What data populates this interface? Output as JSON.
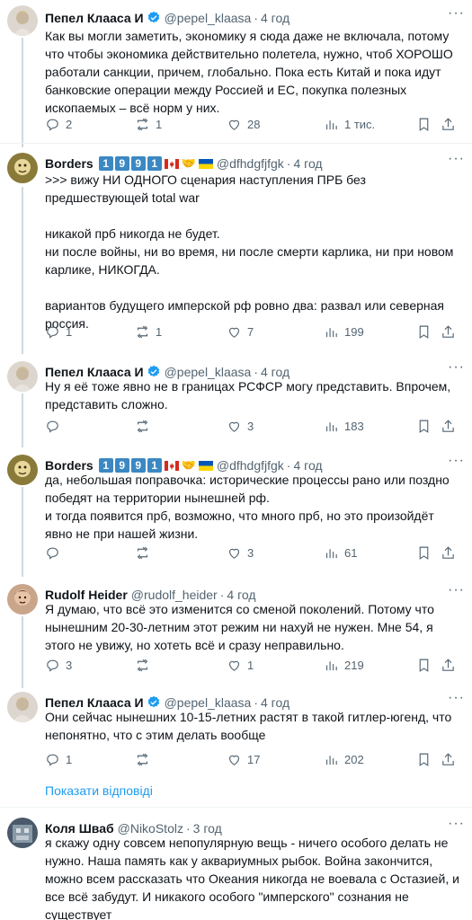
{
  "tweets": [
    {
      "name": "Пепел Клааса И",
      "handle": "@pepel_klaasa",
      "time": "4 год",
      "verified": true,
      "text": "Как вы могли заметить, экономику я сюда даже не включала, потому\nчто чтобы экономика действительно полетела, нужно, чтоб ХОРОШО\nработали санкции, причем, глобально. Пока есть Китай и пока идут\nбанковские операции между Россией и ЕС, покупка полезных\nископаемых – всё норм у них.",
      "replies": "2",
      "retweets": "1",
      "likes": "28",
      "views": "1 тис."
    },
    {
      "name": "Borders",
      "badge_digits": [
        "1",
        "9",
        "9",
        "1"
      ],
      "handle": "@dfhdgfjfgk",
      "time": "4 год",
      "text": ">>>  вижу НИ ОДНОГО сценария наступления ПРБ без\nпредшествующей total war\n\nникакой прб никогда не будет.\nни после войны, ни во время, ни после смерти карлика,  ни при новом\nкарлике, НИКОГДА.\n\nвариантов будущего имперской рф ровно два: развал или северная\nроссия.",
      "replies": "1",
      "retweets": "1",
      "likes": "7",
      "views": "199"
    },
    {
      "name": "Пепел Клааса И",
      "handle": "@pepel_klaasa",
      "time": "4 год",
      "verified": true,
      "text": "Ну я её тоже явно не в границах РСФСР могу представить. Впрочем,\nпредставить сложно.",
      "replies": "",
      "retweets": "",
      "likes": "3",
      "views": "183"
    },
    {
      "name": "Borders",
      "badge_digits": [
        "1",
        "9",
        "9",
        "1"
      ],
      "handle": "@dfhdgfjfgk",
      "time": "4 год",
      "text": "да, небольшая поправочка: исторические процессы рано или поздно\nпобедят на территории нынешней рф.\nи тогда появится прб, возможно, что много прб, но это произойдёт\nявно не при нашей жизни.",
      "replies": "",
      "retweets": "",
      "likes": "3",
      "views": "61"
    },
    {
      "name": "Rudolf Heider",
      "handle": "@rudolf_heider",
      "time": "4 год",
      "text": "Я думаю, что всё это изменится со сменой поколений. Потому что\nнынешним 20-30-летним этот режим ни нахуй не нужен. Мне 54, я\nэтого не увижу, но хотеть всё и сразу неправильно.",
      "replies": "3",
      "retweets": "",
      "likes": "1",
      "views": "219"
    },
    {
      "name": "Пепел Клааса И",
      "handle": "@pepel_klaasa",
      "time": "4 год",
      "verified": true,
      "text": "Они сейчас нынешних 10-15-летних растят в такой гитлер-югенд, что\nнепонятно, что с этим делать вообще",
      "replies": "1",
      "retweets": "",
      "likes": "17",
      "views": "202"
    },
    {
      "name": "Коля Шваб",
      "handle": "@NikoStolz",
      "time": "3 год",
      "text": "я скажу одну совсем непопулярную вещь - ничего особого делать не\nнужно. Наша память как у аквариумных рыбок. Война закончится,\nможно всем рассказать что Океания никогда не воевала с Остазией, и\nвсе всё забудут. И никакого особого \"имперского\" сознания не\nсуществует"
    }
  ],
  "show_replies": "Показати відповіді",
  "colors": {
    "link": "#1d9bf0",
    "muted": "#536471",
    "verified": "#1d9bf0",
    "line": "#cfd9de"
  }
}
